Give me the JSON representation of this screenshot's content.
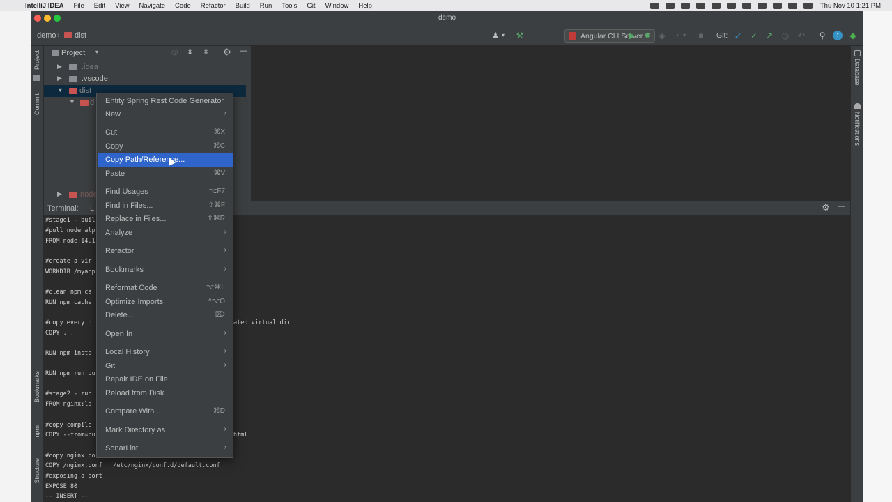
{
  "menubar": {
    "app_name": "IntelliJ IDEA",
    "items": [
      "File",
      "Edit",
      "View",
      "Navigate",
      "Code",
      "Refactor",
      "Build",
      "Run",
      "Tools",
      "Git",
      "Window",
      "Help"
    ],
    "clock": "Thu Nov 10  1:21 PM"
  },
  "window": {
    "title": "demo"
  },
  "navbar": {
    "crumb_project": "demo",
    "crumb_folder": "dist",
    "run_config": "Angular CLI Server",
    "git_label": "Git:"
  },
  "left_strip": {
    "project": "Project",
    "commit": "Commit",
    "bookmarks": "Bookmarks",
    "npm": "npm",
    "structure": "Structure"
  },
  "right_strip": {
    "database": "Database",
    "notifications": "Notifications"
  },
  "project_panel": {
    "title": "Project",
    "rows": [
      ".idea",
      ".vscode",
      "dist",
      "d",
      "node"
    ]
  },
  "terminal": {
    "tab_terminal": "Terminal:",
    "tab_local": "L",
    "lines": [
      "#stage1 - buil",
      "#pull node alp",
      "FROM node:14.1",
      "",
      "#create a vir",
      "WORKDIR /myapp",
      "",
      "#clean npm ca",
      "RUN npm cache",
      "",
      "#copy everyth",
      "COPY . .",
      "",
      "RUN npm insta",
      "",
      "RUN npm run bu",
      "",
      "#stage2 - run",
      "FROM nginx:la",
      "",
      "#copy compile",
      "COPY --from=bu",
      "",
      "#copy nginx co",
      "COPY /nginx.conf   /etc/nginx/conf.d/default.conf",
      "#exposing a port",
      "EXPOSE 80",
      "-- INSERT --"
    ],
    "right_fragment_1": "ated virtual dir",
    "right_fragment_2": "html"
  },
  "context_menu": {
    "items": [
      {
        "label": "Entity Spring Rest Code Generator",
        "shortcut": ""
      },
      {
        "label": "New",
        "shortcut": ""
      },
      {
        "label": "Cut",
        "shortcut": "⌘X"
      },
      {
        "label": "Copy",
        "shortcut": "⌘C"
      },
      {
        "label": "Copy Path/Reference...",
        "shortcut": ""
      },
      {
        "label": "Paste",
        "shortcut": "⌘V"
      },
      {
        "label": "Find Usages",
        "shortcut": "⌥F7"
      },
      {
        "label": "Find in Files...",
        "shortcut": "⇧⌘F"
      },
      {
        "label": "Replace in Files...",
        "shortcut": "⇧⌘R"
      },
      {
        "label": "Analyze",
        "shortcut": ""
      },
      {
        "label": "Refactor",
        "shortcut": ""
      },
      {
        "label": "Bookmarks",
        "shortcut": ""
      },
      {
        "label": "Reformat Code",
        "shortcut": "⌥⌘L"
      },
      {
        "label": "Optimize Imports",
        "shortcut": "^⌥O"
      },
      {
        "label": "Delete...",
        "shortcut": "⌦"
      },
      {
        "label": "Open In",
        "shortcut": ""
      },
      {
        "label": "Local History",
        "shortcut": ""
      },
      {
        "label": "Git",
        "shortcut": ""
      },
      {
        "label": "Repair IDE on File",
        "shortcut": ""
      },
      {
        "label": "Reload from Disk",
        "shortcut": ""
      },
      {
        "label": "Compare With...",
        "shortcut": "⌘D"
      },
      {
        "label": "Mark Directory as",
        "shortcut": ""
      },
      {
        "label": "SonarLint",
        "shortcut": ""
      }
    ],
    "highlighted_index": 4
  },
  "colors": {
    "ide_bg": "#2b2b2b",
    "panel_bg": "#3c3f41",
    "highlight": "#2f65ca",
    "folder_red": "#c75450",
    "run_green": "#59a869",
    "git_blue": "#3592c4"
  }
}
